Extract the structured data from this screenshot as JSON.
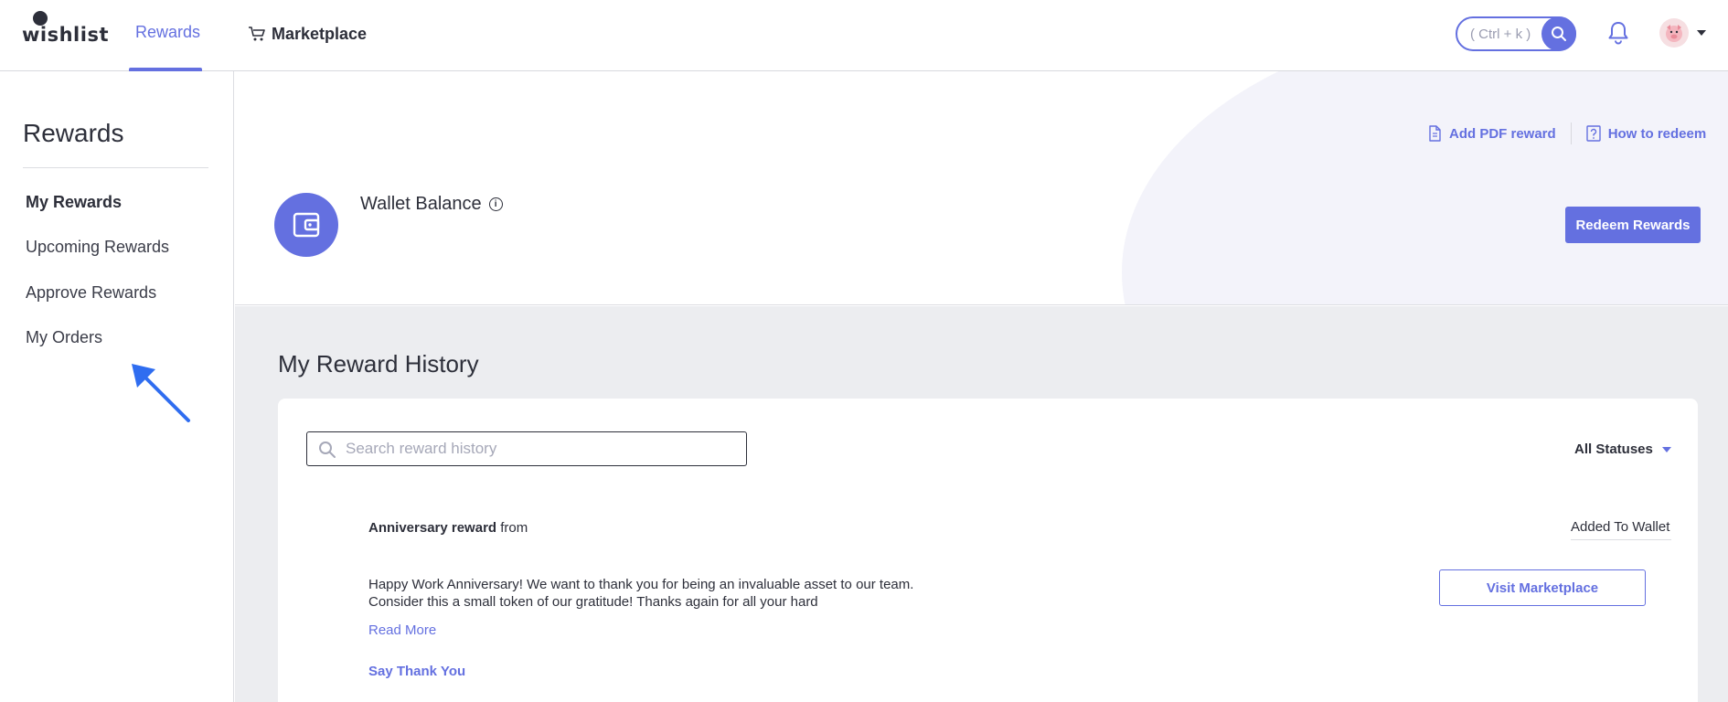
{
  "brand": {
    "name": "wishlist",
    "accent": "#6470e0"
  },
  "nav": {
    "rewards_label": "Rewards",
    "marketplace_label": "Marketplace",
    "search_hint": "( Ctrl + k )"
  },
  "sidebar": {
    "title": "Rewards",
    "items": [
      {
        "label": "My Rewards",
        "active": true
      },
      {
        "label": "Upcoming Rewards"
      },
      {
        "label": "Approve Rewards"
      },
      {
        "label": "My Orders"
      }
    ]
  },
  "wallet": {
    "title": "Wallet Balance",
    "info_icon": "i",
    "add_pdf_label": "Add PDF reward",
    "how_to_redeem_label": "How to redeem",
    "redeem_button_label": "Redeem Rewards"
  },
  "history": {
    "title": "My Reward History",
    "search_placeholder": "Search reward history",
    "status_filter": "All Statuses",
    "reward": {
      "name": "Anniversary reward",
      "from_text": "from",
      "status": "Added To Wallet",
      "message": "Happy Work Anniversary! We want to thank you for being an invaluable asset to our team. Consider this a small token of our gratitude! Thanks again for all your hard",
      "read_more": "Read More",
      "say_thanks": "Say Thank You",
      "visit_button": "Visit Marketplace"
    }
  }
}
